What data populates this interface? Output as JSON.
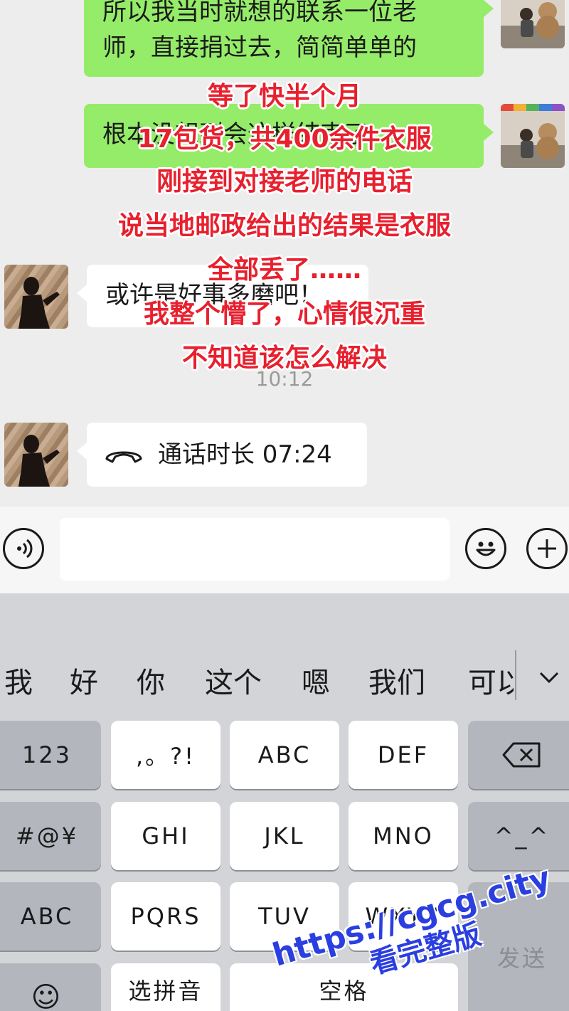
{
  "chat": {
    "messages": [
      {
        "side": "me",
        "text_line1": "所以我当时就想的联系一位老",
        "text_line2": "师，直接捐过去，简简单单的"
      },
      {
        "side": "me",
        "text": "根本没想到会这样结束了"
      },
      {
        "side": "other",
        "text": "或许是好事多磨吧！"
      },
      {
        "side": "other",
        "call_label": "通话时长 07:24"
      }
    ],
    "timestamp": "10:12",
    "captions": [
      "等了快半个月",
      "17包货，共400余件衣服",
      "刚接到对接老师的电话",
      "说当地邮政给出的结果是衣服",
      "全部丢了……",
      "我整个懵了，心情很沉重",
      "不知道该怎么解决"
    ]
  },
  "input_bar": {
    "voice_icon": "voice-icon",
    "message_placeholder": "",
    "emoji_icon": "emoji-icon",
    "plus_icon": "plus-icon"
  },
  "keyboard": {
    "candidates": [
      "我",
      "好",
      "你",
      "这个",
      "嗯",
      "我们",
      "可以"
    ],
    "expand_icon": "chevron-down-icon",
    "rows": [
      [
        "123",
        ",。?!",
        "ABC",
        "DEF",
        "⌫"
      ],
      [
        "#@¥",
        "GHI",
        "JKL",
        "MNO",
        "^_^"
      ],
      [
        "ABC",
        "PQRS",
        "TUV",
        "WXYZ",
        "发送"
      ],
      [
        "☺",
        "选拼音",
        "空格"
      ]
    ]
  },
  "watermark": {
    "line1": "https://cgcg.city",
    "line2": "看完整版"
  }
}
